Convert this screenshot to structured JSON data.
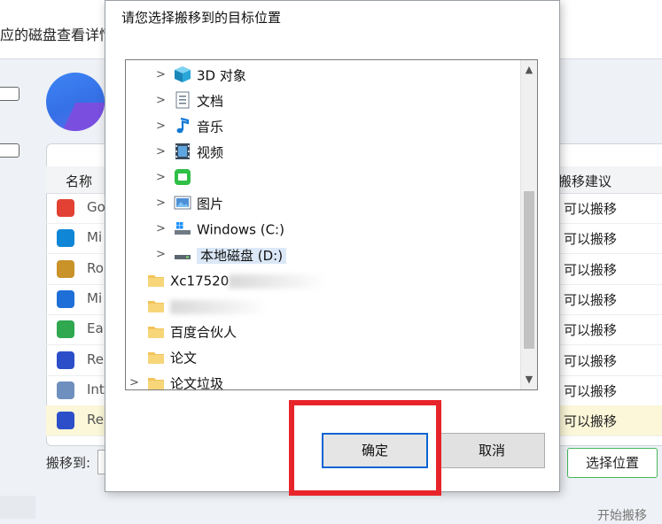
{
  "background": {
    "header_title": "应的磁盘查看详情",
    "columns": {
      "name": "名称",
      "suggestion": "搬移建议"
    },
    "rows": [
      {
        "name": "Go",
        "status": "可以搬移",
        "icon": "chrome-icon",
        "color": "#e34133"
      },
      {
        "name": "Mi",
        "status": "可以搬移",
        "icon": "edge-icon",
        "color": "#0f86d6"
      },
      {
        "name": "Ro",
        "status": "可以搬移",
        "icon": "roblox-icon",
        "color": "#c9932a"
      },
      {
        "name": "Mi",
        "status": "可以搬移",
        "icon": "onedrive-icon",
        "color": "#1e6fd8"
      },
      {
        "name": "Ea",
        "status": "可以搬移",
        "icon": "app-icon-green",
        "color": "#2fa84f"
      },
      {
        "name": "Re",
        "status": "可以搬移",
        "icon": "app-icon-blue",
        "color": "#2c4fc9"
      },
      {
        "name": "Int",
        "status": "可以搬移",
        "icon": "app-icon-grid",
        "color": "#6f8fbf"
      },
      {
        "name": "Re",
        "status": "可以搬移",
        "icon": "app-icon-blue",
        "color": "#2c4fc9",
        "selected": true
      }
    ],
    "move_to_label": "搬移到:",
    "choose_location_button": "选择位置",
    "start_button": "开始搬移"
  },
  "dialog": {
    "prompt": "请您选择搬移到的目标位置",
    "tree": [
      {
        "label": "3D 对象",
        "icon": "3d-objects-icon",
        "indent": 1,
        "chevron": ">"
      },
      {
        "label": "文档",
        "icon": "documents-icon",
        "indent": 1,
        "chevron": ">"
      },
      {
        "label": "音乐",
        "icon": "music-icon",
        "indent": 1,
        "chevron": ">"
      },
      {
        "label": "视频",
        "icon": "video-icon",
        "indent": 1,
        "chevron": ">"
      },
      {
        "label": "",
        "icon": "green-app-icon",
        "indent": 1,
        "chevron": ">"
      },
      {
        "label": "图片",
        "icon": "pictures-icon",
        "indent": 1,
        "chevron": ">"
      },
      {
        "label": "Windows (C:)",
        "icon": "drive-c-icon",
        "indent": 1,
        "chevron": ">"
      },
      {
        "label": "本地磁盘 (D:)",
        "icon": "drive-d-icon",
        "indent": 1,
        "chevron": ">",
        "selected": true
      },
      {
        "label": "Xc17520",
        "icon": "folder-icon",
        "indent": 0,
        "chevron": "",
        "blurred": true
      },
      {
        "label": "",
        "icon": "folder-icon",
        "indent": 0,
        "chevron": "",
        "blurred": true
      },
      {
        "label": "百度合伙人",
        "icon": "folder-icon",
        "indent": 0,
        "chevron": ""
      },
      {
        "label": "论文",
        "icon": "folder-icon",
        "indent": 0,
        "chevron": ""
      },
      {
        "label": "论文垃圾",
        "icon": "folder-icon",
        "indent": 0,
        "chevron": ">"
      }
    ],
    "ok_button": "确定",
    "cancel_button": "取消"
  },
  "colors": {
    "highlight": "#e8242b",
    "focus_border": "#0a64d4",
    "selection": "#dbe8f7"
  }
}
